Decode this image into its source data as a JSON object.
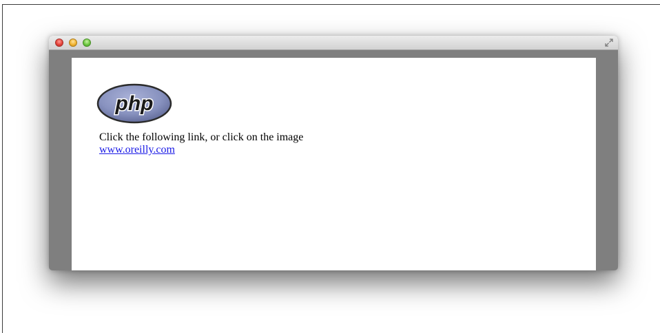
{
  "window": {
    "buttons": [
      "close",
      "minimize",
      "zoom"
    ],
    "fullscreen_icon": "fullscreen-arrows-icon"
  },
  "page": {
    "logo_text": "php",
    "logo_colors": {
      "fill": "#8892bf",
      "outline": "#2b2b2b",
      "text": "#1a1a1a"
    },
    "text": "Click the following link, or click on the image",
    "link_text": "www.oreilly.com",
    "link_color": "#1a1ae6"
  }
}
